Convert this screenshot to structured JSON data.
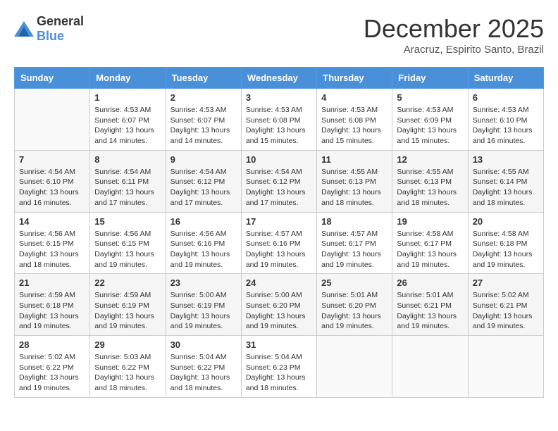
{
  "logo": {
    "general": "General",
    "blue": "Blue"
  },
  "title": "December 2025",
  "location": "Aracruz, Espirito Santo, Brazil",
  "days_of_week": [
    "Sunday",
    "Monday",
    "Tuesday",
    "Wednesday",
    "Thursday",
    "Friday",
    "Saturday"
  ],
  "weeks": [
    [
      {
        "day": "",
        "info": ""
      },
      {
        "day": "1",
        "info": "Sunrise: 4:53 AM\nSunset: 6:07 PM\nDaylight: 13 hours and 14 minutes."
      },
      {
        "day": "2",
        "info": "Sunrise: 4:53 AM\nSunset: 6:07 PM\nDaylight: 13 hours and 14 minutes."
      },
      {
        "day": "3",
        "info": "Sunrise: 4:53 AM\nSunset: 6:08 PM\nDaylight: 13 hours and 15 minutes."
      },
      {
        "day": "4",
        "info": "Sunrise: 4:53 AM\nSunset: 6:08 PM\nDaylight: 13 hours and 15 minutes."
      },
      {
        "day": "5",
        "info": "Sunrise: 4:53 AM\nSunset: 6:09 PM\nDaylight: 13 hours and 15 minutes."
      },
      {
        "day": "6",
        "info": "Sunrise: 4:53 AM\nSunset: 6:10 PM\nDaylight: 13 hours and 16 minutes."
      }
    ],
    [
      {
        "day": "7",
        "info": "Sunrise: 4:54 AM\nSunset: 6:10 PM\nDaylight: 13 hours and 16 minutes."
      },
      {
        "day": "8",
        "info": "Sunrise: 4:54 AM\nSunset: 6:11 PM\nDaylight: 13 hours and 17 minutes."
      },
      {
        "day": "9",
        "info": "Sunrise: 4:54 AM\nSunset: 6:12 PM\nDaylight: 13 hours and 17 minutes."
      },
      {
        "day": "10",
        "info": "Sunrise: 4:54 AM\nSunset: 6:12 PM\nDaylight: 13 hours and 17 minutes."
      },
      {
        "day": "11",
        "info": "Sunrise: 4:55 AM\nSunset: 6:13 PM\nDaylight: 13 hours and 18 minutes."
      },
      {
        "day": "12",
        "info": "Sunrise: 4:55 AM\nSunset: 6:13 PM\nDaylight: 13 hours and 18 minutes."
      },
      {
        "day": "13",
        "info": "Sunrise: 4:55 AM\nSunset: 6:14 PM\nDaylight: 13 hours and 18 minutes."
      }
    ],
    [
      {
        "day": "14",
        "info": "Sunrise: 4:56 AM\nSunset: 6:15 PM\nDaylight: 13 hours and 18 minutes."
      },
      {
        "day": "15",
        "info": "Sunrise: 4:56 AM\nSunset: 6:15 PM\nDaylight: 13 hours and 19 minutes."
      },
      {
        "day": "16",
        "info": "Sunrise: 4:56 AM\nSunset: 6:16 PM\nDaylight: 13 hours and 19 minutes."
      },
      {
        "day": "17",
        "info": "Sunrise: 4:57 AM\nSunset: 6:16 PM\nDaylight: 13 hours and 19 minutes."
      },
      {
        "day": "18",
        "info": "Sunrise: 4:57 AM\nSunset: 6:17 PM\nDaylight: 13 hours and 19 minutes."
      },
      {
        "day": "19",
        "info": "Sunrise: 4:58 AM\nSunset: 6:17 PM\nDaylight: 13 hours and 19 minutes."
      },
      {
        "day": "20",
        "info": "Sunrise: 4:58 AM\nSunset: 6:18 PM\nDaylight: 13 hours and 19 minutes."
      }
    ],
    [
      {
        "day": "21",
        "info": "Sunrise: 4:59 AM\nSunset: 6:18 PM\nDaylight: 13 hours and 19 minutes."
      },
      {
        "day": "22",
        "info": "Sunrise: 4:59 AM\nSunset: 6:19 PM\nDaylight: 13 hours and 19 minutes."
      },
      {
        "day": "23",
        "info": "Sunrise: 5:00 AM\nSunset: 6:19 PM\nDaylight: 13 hours and 19 minutes."
      },
      {
        "day": "24",
        "info": "Sunrise: 5:00 AM\nSunset: 6:20 PM\nDaylight: 13 hours and 19 minutes."
      },
      {
        "day": "25",
        "info": "Sunrise: 5:01 AM\nSunset: 6:20 PM\nDaylight: 13 hours and 19 minutes."
      },
      {
        "day": "26",
        "info": "Sunrise: 5:01 AM\nSunset: 6:21 PM\nDaylight: 13 hours and 19 minutes."
      },
      {
        "day": "27",
        "info": "Sunrise: 5:02 AM\nSunset: 6:21 PM\nDaylight: 13 hours and 19 minutes."
      }
    ],
    [
      {
        "day": "28",
        "info": "Sunrise: 5:02 AM\nSunset: 6:22 PM\nDaylight: 13 hours and 19 minutes."
      },
      {
        "day": "29",
        "info": "Sunrise: 5:03 AM\nSunset: 6:22 PM\nDaylight: 13 hours and 18 minutes."
      },
      {
        "day": "30",
        "info": "Sunrise: 5:04 AM\nSunset: 6:22 PM\nDaylight: 13 hours and 18 minutes."
      },
      {
        "day": "31",
        "info": "Sunrise: 5:04 AM\nSunset: 6:23 PM\nDaylight: 13 hours and 18 minutes."
      },
      {
        "day": "",
        "info": ""
      },
      {
        "day": "",
        "info": ""
      },
      {
        "day": "",
        "info": ""
      }
    ]
  ]
}
